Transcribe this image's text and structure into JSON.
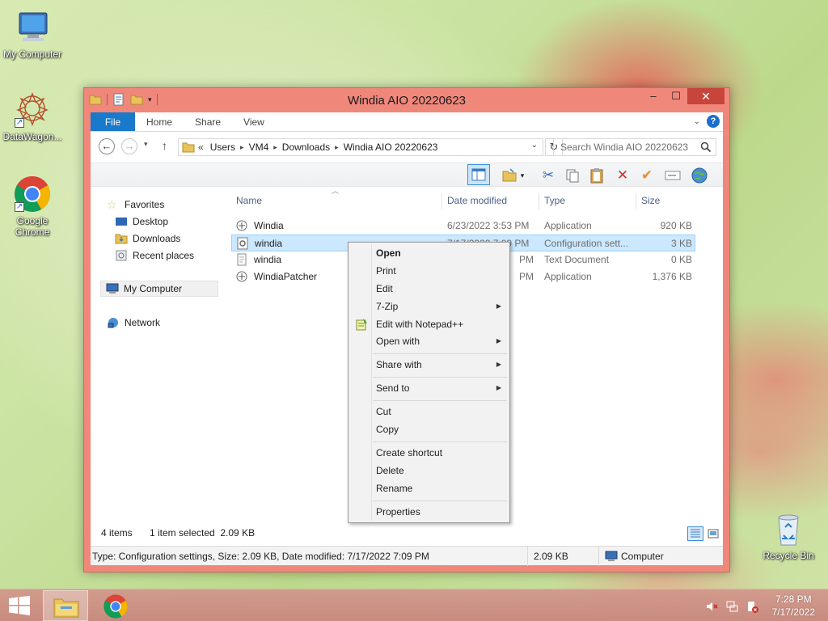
{
  "desktop": {
    "icons": [
      {
        "label": "My Computer"
      },
      {
        "label": "DataWagon..."
      },
      {
        "label": "Google Chrome"
      },
      {
        "label": "Recycle Bin"
      }
    ]
  },
  "window": {
    "title": "Windia AIO 20220623",
    "buttons": {
      "minimize": "–",
      "maximize": "☐",
      "close": "✕"
    }
  },
  "ribbon": {
    "tabs": [
      {
        "label": "File"
      },
      {
        "label": "Home"
      },
      {
        "label": "Share"
      },
      {
        "label": "View"
      }
    ],
    "help": "?"
  },
  "address": {
    "prefix": "«",
    "crumbs": [
      "Users",
      "VM4",
      "Downloads",
      "Windia AIO 20220623"
    ],
    "search_placeholder": "Search Windia AIO 20220623"
  },
  "navpane": {
    "favorites": "Favorites",
    "desktop": "Desktop",
    "downloads": "Downloads",
    "recent": "Recent places",
    "computer": "My Computer",
    "network": "Network"
  },
  "filelist": {
    "columns": {
      "name": "Name",
      "date": "Date modified",
      "type": "Type",
      "size": "Size"
    },
    "rows": [
      {
        "name": "Windia",
        "date": "6/23/2022 3:53 PM",
        "type": "Application",
        "size": "920 KB"
      },
      {
        "name": "windia",
        "date": "7/17/2022 7:09 PM",
        "type": "Configuration sett...",
        "size": "3 KB"
      },
      {
        "name": "windia",
        "date": "PM",
        "type": "Text Document",
        "size": "0 KB"
      },
      {
        "name": "WindiaPatcher",
        "date": "PM",
        "type": "Application",
        "size": "1,376 KB"
      }
    ]
  },
  "status": {
    "items": "4 items",
    "selected": "1 item selected  2.09 KB",
    "details": "Type: Configuration settings, Size: 2.09 KB, Date modified: 7/17/2022 7:09 PM",
    "size": "2.09 KB",
    "location": "Computer"
  },
  "context_menu": {
    "items": [
      {
        "label": "Open"
      },
      {
        "label": "Print"
      },
      {
        "label": "Edit"
      },
      {
        "label": "7-Zip"
      },
      {
        "label": "Edit with Notepad++"
      },
      {
        "label": "Open with"
      },
      {
        "label": "Share with"
      },
      {
        "label": "Send to"
      },
      {
        "label": "Cut"
      },
      {
        "label": "Copy"
      },
      {
        "label": "Create shortcut"
      },
      {
        "label": "Delete"
      },
      {
        "label": "Rename"
      },
      {
        "label": "Properties"
      }
    ]
  },
  "taskbar": {
    "time": "7:28 PM",
    "date": "7/17/2022"
  },
  "colors": {
    "window_frame": "#f0877b",
    "accent": "#1979ca",
    "selection": "#cce8ff"
  }
}
